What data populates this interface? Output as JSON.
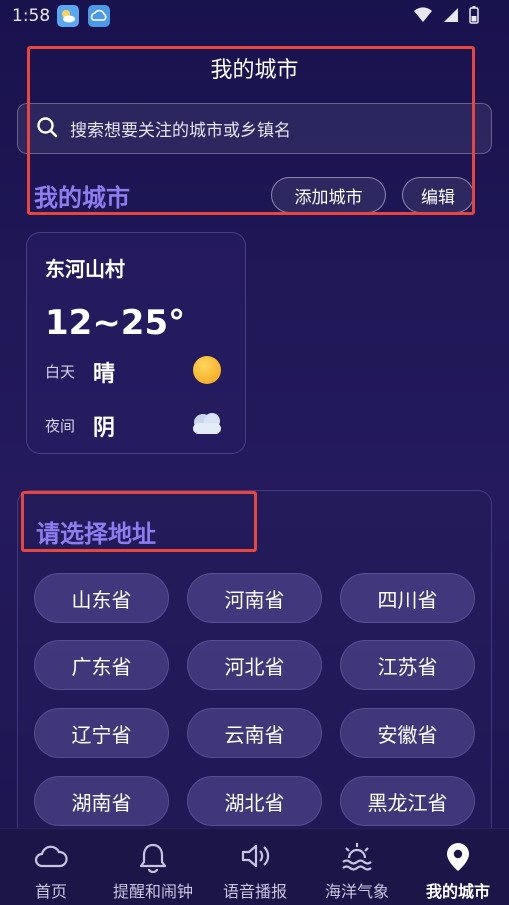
{
  "status_bar": {
    "time": "1:58"
  },
  "header": {
    "title": "我的城市",
    "search_placeholder": "搜索想要关注的城市或乡镇名"
  },
  "my_cities": {
    "section_title": "我的城市",
    "add_city_label": "添加城市",
    "edit_label": "编辑",
    "cards": [
      {
        "name": "东河山村",
        "temp_range": "12~25°",
        "day_label": "白天",
        "day_weather": "晴",
        "day_icon": "sun-icon",
        "night_label": "夜间",
        "night_weather": "阴",
        "night_icon": "cloud-icon"
      }
    ]
  },
  "address_picker": {
    "title": "请选择地址",
    "provinces": [
      "山东省",
      "河南省",
      "四川省",
      "广东省",
      "河北省",
      "江苏省",
      "辽宁省",
      "云南省",
      "安徽省",
      "湖南省",
      "湖北省",
      "黑龙江省"
    ]
  },
  "bottom_nav": {
    "items": [
      {
        "label": "首页",
        "icon": "cloud-icon",
        "active": false
      },
      {
        "label": "提醒和闹钟",
        "icon": "bell-icon",
        "active": false
      },
      {
        "label": "语音播报",
        "icon": "speaker-icon",
        "active": false
      },
      {
        "label": "海洋气象",
        "icon": "sunrise-waves-icon",
        "active": false
      },
      {
        "label": "我的城市",
        "icon": "location-pin-icon",
        "active": true
      }
    ]
  },
  "colors": {
    "accent_purple": "#8e7df0",
    "annotation_red": "#e8463c",
    "background": "#1f1756"
  }
}
